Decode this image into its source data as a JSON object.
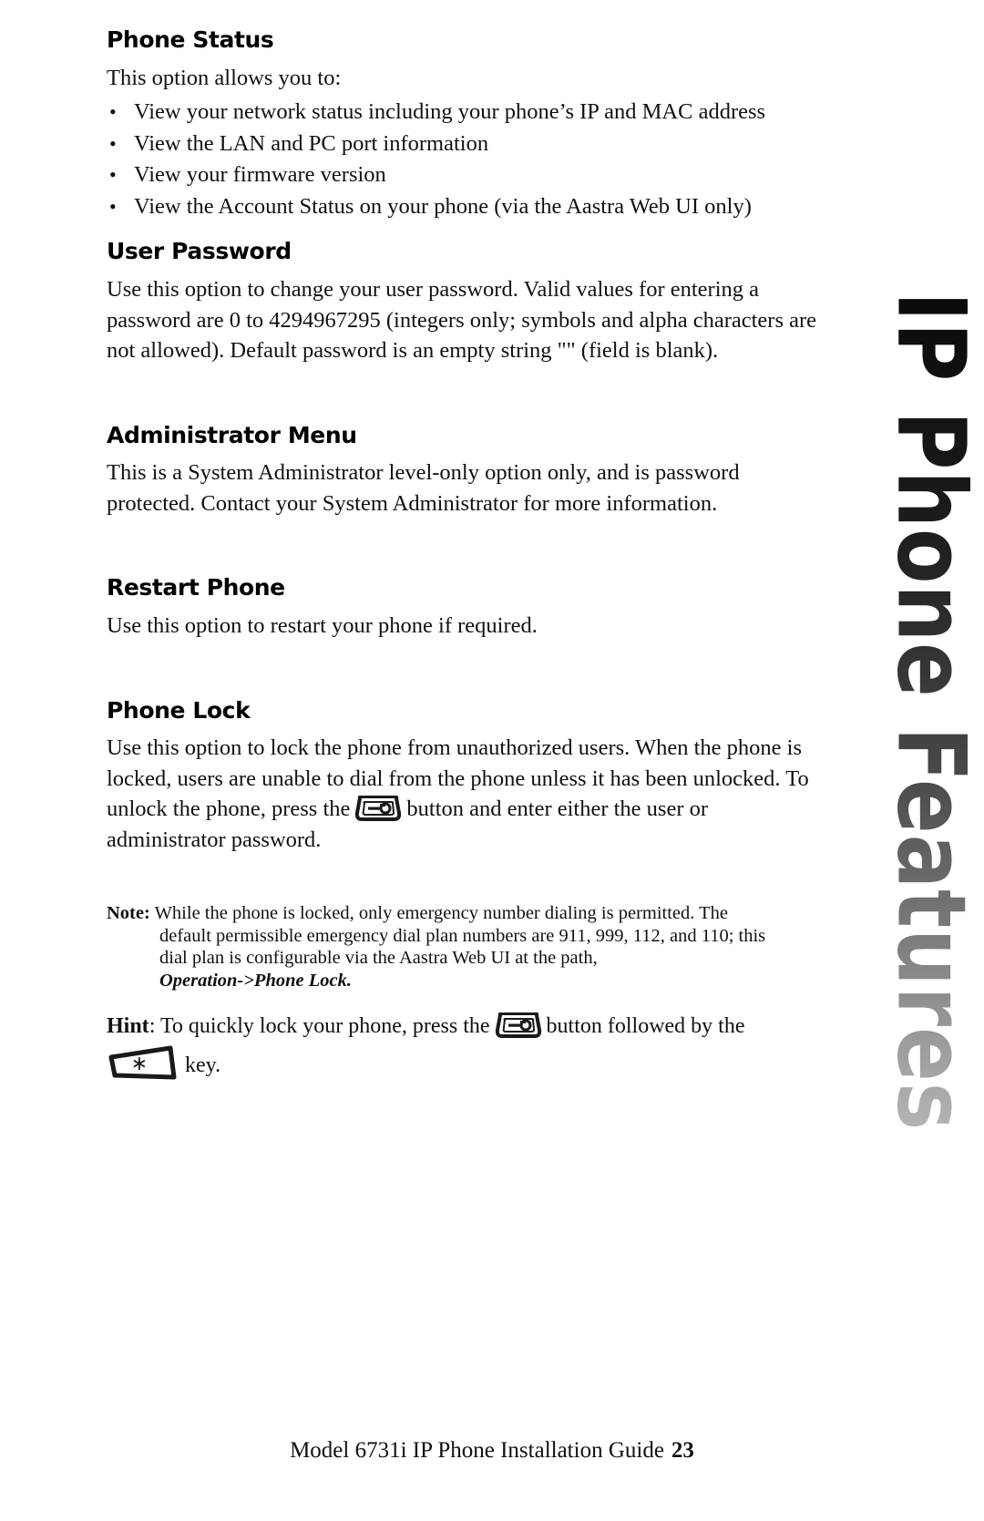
{
  "document": {
    "sections": [
      {
        "id": "phone-status",
        "heading": "Phone Status",
        "intro": "This option allows you to:",
        "bullets": [
          "View your network status including your phone’s IP and MAC address",
          "View the LAN and PC port information",
          "View your firmware version",
          "View the Account Status on your phone (via the Aastra Web UI only)"
        ]
      },
      {
        "id": "user-password",
        "heading": "User Password",
        "body": "Use this option to change your user password. Valid values for entering a password are 0 to 4294967295 (integers only; symbols and alpha characters are not allowed). Default password is an empty string \"\" (field is blank)."
      },
      {
        "id": "administrator-menu",
        "heading": "Administrator Menu",
        "body": "This is a System Administrator level-only option only, and is password protected. Contact your System Administrator for more information."
      },
      {
        "id": "restart-phone",
        "heading": "Restart Phone",
        "body": "Use this option to restart your phone if required."
      },
      {
        "id": "phone-lock",
        "heading": "Phone Lock",
        "body_part1": "Use this option to lock the phone from unauthorized users.  When the phone is locked, users are unable to dial from the phone unless it has been unlocked.  To unlock the phone, press the",
        "body_part2": "button and enter either the user or administrator password."
      }
    ],
    "note": {
      "label": "Note:",
      "line1": "While the phone is locked, only emergency number dialing is permitted.  The",
      "line2": "default permissible emergency dial plan numbers are 911, 999, 112, and 110; this",
      "line3": "dial plan is configurable via the Aastra Web UI at the path,",
      "path": "Operation->Phone Lock."
    },
    "hint": {
      "label": "Hint",
      "separator": ":",
      "part1": "To quickly lock your phone, press the",
      "part2": "button followed by the",
      "part3": "key."
    },
    "icons": {
      "options_key": "options-key-icon",
      "star_key": "star-key-icon",
      "star_glyph": "∗"
    },
    "side_tab": {
      "text": "IP Phone Features"
    },
    "footer": {
      "text": "Model 6731i IP Phone Installation Guide",
      "page_number": "23"
    },
    "colors": {
      "text": "#111111",
      "background": "#ffffff",
      "side_tab_dark": "#0a0a0a",
      "side_tab_light": "#b5b5b5"
    }
  }
}
